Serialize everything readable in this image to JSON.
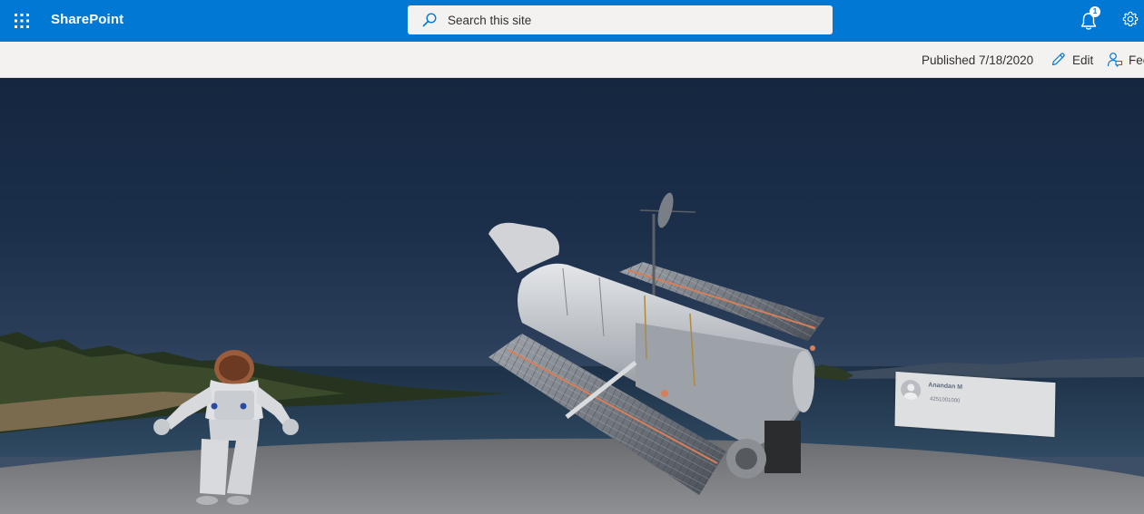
{
  "suite_bar": {
    "app_name": "SharePoint",
    "search_placeholder": "Search this site",
    "notification_count": "1",
    "accent_color": "#0078d4"
  },
  "command_bar": {
    "published_text": "Published 7/18/2020",
    "edit_label": "Edit",
    "feedback_label": "Fee"
  },
  "space": {
    "objects": [
      "astronaut",
      "hubble-telescope",
      "contact-card"
    ],
    "contact_card": {
      "name": "Anandan M",
      "phone": "4251001000"
    }
  }
}
